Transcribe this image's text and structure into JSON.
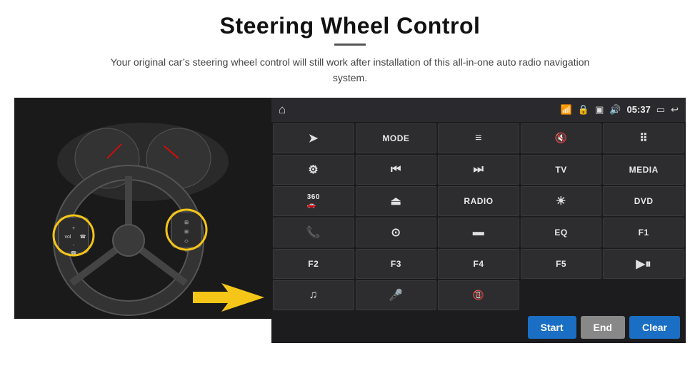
{
  "header": {
    "title": "Steering Wheel Control",
    "subtitle": "Your original car’s steering wheel control will still work after installation of this all-in-one auto radio navigation system."
  },
  "topbar": {
    "time": "05:37"
  },
  "grid": {
    "rows": [
      [
        {
          "type": "icon",
          "label": "send",
          "symbol": "➤"
        },
        {
          "type": "text",
          "label": "MODE"
        },
        {
          "type": "icon",
          "label": "list",
          "symbol": "≡"
        },
        {
          "type": "icon",
          "label": "mute",
          "symbol": "🔇"
        },
        {
          "type": "icon",
          "label": "apps",
          "symbol": "⋯"
        }
      ],
      [
        {
          "type": "icon",
          "label": "settings",
          "symbol": "⚙"
        },
        {
          "type": "icon",
          "label": "rewind",
          "symbol": "⏮"
        },
        {
          "type": "icon",
          "label": "forward",
          "symbol": "⏭"
        },
        {
          "type": "text",
          "label": "TV"
        },
        {
          "type": "text",
          "label": "MEDIA"
        }
      ],
      [
        {
          "type": "icon",
          "label": "360cam",
          "symbol": "🎥"
        },
        {
          "type": "icon",
          "label": "eject",
          "symbol": "⏏"
        },
        {
          "type": "text",
          "label": "RADIO"
        },
        {
          "type": "icon",
          "label": "brightness",
          "symbol": "☀"
        },
        {
          "type": "text",
          "label": "DVD"
        }
      ],
      [
        {
          "type": "icon",
          "label": "phone",
          "symbol": "📞"
        },
        {
          "type": "icon",
          "label": "navigation",
          "symbol": "⊙"
        },
        {
          "type": "icon",
          "label": "screen",
          "symbol": "▬"
        },
        {
          "type": "text",
          "label": "EQ"
        },
        {
          "type": "text",
          "label": "F1"
        }
      ],
      [
        {
          "type": "text",
          "label": "F2"
        },
        {
          "type": "text",
          "label": "F3"
        },
        {
          "type": "text",
          "label": "F4"
        },
        {
          "type": "text",
          "label": "F5"
        },
        {
          "type": "icon",
          "label": "playpause",
          "symbol": "▶⏸"
        }
      ],
      [
        {
          "type": "icon",
          "label": "music",
          "symbol": "♫"
        },
        {
          "type": "icon",
          "label": "mic",
          "symbol": "🎤"
        },
        {
          "type": "icon",
          "label": "call",
          "symbol": "📵"
        }
      ]
    ],
    "buttons": {
      "start": "Start",
      "end": "End",
      "clear": "Clear"
    }
  }
}
